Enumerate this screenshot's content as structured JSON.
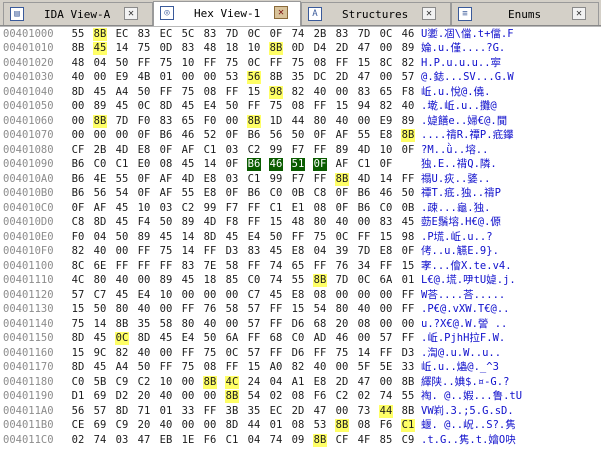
{
  "tabs": [
    {
      "label": "IDA View-A",
      "icon": "ida-view-icon",
      "active": false
    },
    {
      "label": "Hex View-1",
      "icon": "hex-view-icon",
      "active": true
    },
    {
      "label": "Structures",
      "icon": "structures-icon",
      "active": false
    },
    {
      "label": "Enums",
      "icon": "enums-icon",
      "active": false
    }
  ],
  "rows": [
    {
      "addr": "00401000",
      "hex": [
        "55",
        "8B",
        "EC",
        "83",
        "EC",
        "5C",
        "83",
        "7D",
        "0C",
        "0F",
        "74",
        "2B",
        "83",
        "7D",
        "0C",
        "46"
      ],
      "ascii": "U嬱.凅\\儅.t+儅.F"
    },
    {
      "addr": "00401010",
      "hex": [
        "8B",
        "45",
        "14",
        "75",
        "0D",
        "83",
        "48",
        "18",
        "10",
        "8B",
        "0D",
        "D4",
        "2D",
        "47",
        "00",
        "89"
      ],
      "ascii": "婨.u.僅....?G."
    },
    {
      "addr": "00401020",
      "hex": [
        "48",
        "04",
        "50",
        "FF",
        "75",
        "10",
        "FF",
        "75",
        "0C",
        "FF",
        "75",
        "08",
        "FF",
        "15",
        "8C",
        "82"
      ],
      "ascii": "H.P.u.u.u..寕"
    },
    {
      "addr": "00401030",
      "hex": [
        "40",
        "00",
        "E9",
        "4B",
        "01",
        "00",
        "00",
        "53",
        "56",
        "8B",
        "35",
        "DC",
        "2D",
        "47",
        "00",
        "57"
      ],
      "ascii": "@.鋕...SV...G.W"
    },
    {
      "addr": "00401040",
      "hex": [
        "8D",
        "45",
        "A4",
        "50",
        "FF",
        "75",
        "08",
        "FF",
        "15",
        "98",
        "82",
        "40",
        "00",
        "83",
        "65",
        "F8"
      ],
      "ascii": "岴.u.悅@.僥."
    },
    {
      "addr": "00401050",
      "hex": [
        "00",
        "89",
        "45",
        "0C",
        "8D",
        "45",
        "E4",
        "50",
        "FF",
        "75",
        "08",
        "FF",
        "15",
        "94",
        "82",
        "40"
      ],
      "ascii": ".墘.岴.u..攤@"
    },
    {
      "addr": "00401060",
      "hex": [
        "00",
        "8B",
        "7D",
        "F0",
        "83",
        "65",
        "F0",
        "00",
        "8B",
        "1D",
        "44",
        "80",
        "40",
        "00",
        "E9",
        "89"
      ],
      "ascii": ".媫饍e..婦€@.閴"
    },
    {
      "addr": "00401070",
      "hex": [
        "00",
        "00",
        "00",
        "0F",
        "B6",
        "46",
        "52",
        "0F",
        "B6",
        "56",
        "50",
        "0F",
        "AF",
        "55",
        "E8",
        "8B"
      ],
      "ascii": "....禙R.禫P.疷鑻"
    },
    {
      "addr": "00401080",
      "hex": [
        "CF",
        "2B",
        "4D",
        "E8",
        "0F",
        "AF",
        "C1",
        "03",
        "C2",
        "99",
        "F7",
        "FF",
        "89",
        "4D",
        "10",
        "0F"
      ],
      "ascii": "?M..ǜ..塎.."
    },
    {
      "addr": "00401090",
      "hex": [
        "B6",
        "C0",
        "C1",
        "E0",
        "08",
        "45",
        "14",
        "0F",
        "B6",
        "46",
        "51",
        "0F",
        "AF",
        "C1",
        "0F"
      ],
      "ascii": "独.E..禙Q.隣."
    },
    {
      "addr": "004010A0",
      "hex": [
        "B6",
        "4E",
        "55",
        "0F",
        "AF",
        "4D",
        "E8",
        "03",
        "C1",
        "99",
        "F7",
        "FF",
        "8B",
        "4D",
        "14",
        "FF"
      ],
      "ascii": "禢U.疢..婱.."
    },
    {
      "addr": "004010B0",
      "hex": [
        "B6",
        "56",
        "54",
        "0F",
        "AF",
        "55",
        "E8",
        "0F",
        "B6",
        "C0",
        "0B",
        "C8",
        "0F",
        "B6",
        "46",
        "50"
      ],
      "ascii": "禫T.疷.独..禙P"
    },
    {
      "addr": "004010C0",
      "hex": [
        "0F",
        "AF",
        "45",
        "10",
        "03",
        "C2",
        "99",
        "F7",
        "FF",
        "C1",
        "E1",
        "08",
        "0F",
        "B6",
        "C0",
        "0B"
      ],
      "ascii": ".疎...龜.独."
    },
    {
      "addr": "004010D0",
      "hex": [
        "C8",
        "8D",
        "45",
        "F4",
        "50",
        "89",
        "4D",
        "F8",
        "FF",
        "15",
        "48",
        "80",
        "40",
        "00",
        "83",
        "45"
      ],
      "ascii": "葝E鬚塎.H€@.傆"
    },
    {
      "addr": "004010E0",
      "hex": [
        "F0",
        "04",
        "50",
        "89",
        "45",
        "14",
        "8D",
        "45",
        "E4",
        "50",
        "FF",
        "75",
        "0C",
        "FF",
        "15",
        "98"
      ],
      "ascii": ".P塃.岴.u..?"
    },
    {
      "addr": "004010F0",
      "hex": [
        "82",
        "40",
        "00",
        "FF",
        "75",
        "14",
        "FF",
        "D3",
        "83",
        "45",
        "E8",
        "04",
        "39",
        "7D",
        "E8",
        "0F"
      ],
      "ascii": "侤..u.觾E.9}."
    },
    {
      "addr": "00401100",
      "hex": [
        "8C",
        "6E",
        "FF",
        "FF",
        "FF",
        "83",
        "7E",
        "58",
        "FF",
        "74",
        "65",
        "FF",
        "76",
        "34",
        "FF",
        "15"
      ],
      "ascii": "宯...儈X.te.v4."
    },
    {
      "addr": "00401110",
      "addr_note": "",
      "hex": [
        "4C",
        "80",
        "40",
        "00",
        "89",
        "45",
        "18",
        "85",
        "C0",
        "74",
        "55",
        "8B",
        "7D",
        "0C",
        "6A",
        "01"
      ],
      "ascii": "L€@.塃.吚tU媫.j."
    },
    {
      "addr": "00401120",
      "hex": [
        "57",
        "C7",
        "45",
        "E4",
        "10",
        "00",
        "00",
        "00",
        "C7",
        "45",
        "E8",
        "08",
        "00",
        "00",
        "00",
        "FF"
      ],
      "ascii": "W荅....荅....."
    },
    {
      "addr": "00401130",
      "hex": [
        "15",
        "50",
        "80",
        "40",
        "00",
        "FF",
        "76",
        "58",
        "57",
        "FF",
        "15",
        "54",
        "80",
        "40",
        "00",
        "FF"
      ],
      "ascii": ".P€@.vXW.T€@.."
    },
    {
      "addr": "00401140",
      "hex": [
        "75",
        "14",
        "8B",
        "35",
        "58",
        "80",
        "40",
        "00",
        "57",
        "FF",
        "D6",
        "68",
        "20",
        "08",
        "00",
        "00"
      ],
      "ascii": "u.?X€@.W.謍 .."
    },
    {
      "addr": "00401150",
      "hex": [
        "8D",
        "45",
        "0C",
        "8D",
        "45",
        "E4",
        "50",
        "6A",
        "FF",
        "68",
        "C0",
        "AD",
        "46",
        "00",
        "57",
        "FF"
      ],
      "ascii": ".岴.PjhH拉F.W."
    },
    {
      "addr": "00401160",
      "hex": [
        "15",
        "9C",
        "82",
        "40",
        "00",
        "FF",
        "75",
        "0C",
        "57",
        "FF",
        "D6",
        "FF",
        "75",
        "14",
        "FF",
        "D3"
      ],
      "ascii": ".渹@.u.W..u.."
    },
    {
      "addr": "00401170",
      "hex": [
        "8D",
        "45",
        "A4",
        "50",
        "FF",
        "75",
        "08",
        "FF",
        "15",
        "A0",
        "82",
        "40",
        "00",
        "5F",
        "5E",
        "33"
      ],
      "ascii": "岴.u..爞@._^3"
    },
    {
      "addr": "00401180",
      "hex": [
        "C0",
        "5B",
        "C9",
        "C2",
        "10",
        "00",
        "8B",
        "4C",
        "24",
        "04",
        "A1",
        "E8",
        "2D",
        "47",
        "00",
        "8B"
      ],
      "ascii": "繹陕..婰$.¤-G.?"
    },
    {
      "addr": "00401190",
      "hex": [
        "D1",
        "69",
        "D2",
        "20",
        "40",
        "00",
        "00",
        "8B",
        "54",
        "02",
        "08",
        "F6",
        "C2",
        "02",
        "74",
        "55"
      ],
      "ascii": "裪. @..婽...鲁.tU"
    },
    {
      "addr": "004011A0",
      "hex": [
        "56",
        "57",
        "8D",
        "71",
        "01",
        "33",
        "FF",
        "3B",
        "35",
        "EC",
        "2D",
        "47",
        "00",
        "73",
        "44",
        "8B"
      ],
      "ascii": "VW峲.3.;5.G.sD."
    },
    {
      "addr": "004011B0",
      "hex": [
        "CE",
        "69",
        "C9",
        "20",
        "40",
        "00",
        "00",
        "8D",
        "44",
        "01",
        "08",
        "53",
        "8B",
        "08",
        "F6",
        "C1"
      ],
      "ascii": "蝘. @..岲..S?.隽"
    },
    {
      "addr": "004011C0",
      "hex": [
        "02",
        "74",
        "03",
        "47",
        "EB",
        "1E",
        "F6",
        "C1",
        "04",
        "74",
        "09",
        "8B",
        "CF",
        "4F",
        "85",
        "C9"
      ],
      "ascii": ".t.G..隽.t.嬒O吷"
    }
  ],
  "highlights": [
    [
      0,
      1
    ],
    [
      1,
      1
    ],
    [
      1,
      9
    ],
    [
      3,
      8
    ],
    [
      4,
      9
    ],
    [
      6,
      1
    ],
    [
      6,
      8
    ],
    [
      7,
      15
    ],
    [
      9,
      15
    ],
    [
      10,
      12
    ],
    [
      17,
      11
    ],
    [
      21,
      2
    ],
    [
      24,
      6
    ],
    [
      24,
      7
    ],
    [
      25,
      7
    ],
    [
      26,
      14
    ],
    [
      27,
      12
    ],
    [
      27,
      15
    ],
    [
      28,
      11
    ]
  ],
  "selection": {
    "row": 9,
    "cols": [
      8,
      9,
      10,
      11
    ]
  }
}
